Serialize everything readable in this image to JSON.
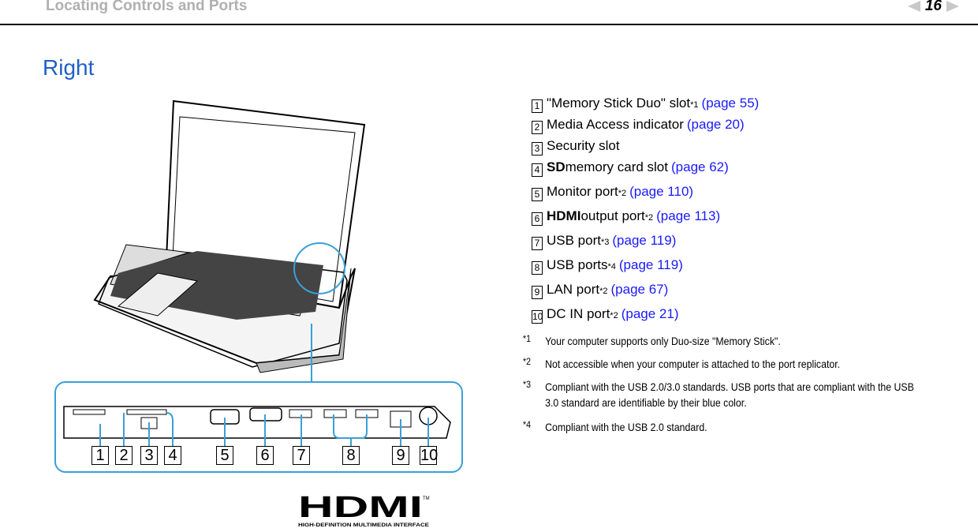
{
  "header": {
    "section": "Locating Controls and Ports",
    "page": "16"
  },
  "title": "Right",
  "items": [
    {
      "n": "1",
      "pre": "",
      "bold": "",
      "text": "\"Memory Stick Duo\" slot",
      "sup": "*1",
      "link": "(page 55)"
    },
    {
      "n": "2",
      "pre": "",
      "bold": "",
      "text": "Media Access indicator",
      "sup": "",
      "link": "(page 20)"
    },
    {
      "n": "3",
      "pre": "",
      "bold": "",
      "text": "Security slot",
      "sup": "",
      "link": ""
    },
    {
      "n": "4",
      "bold": "SD",
      "text": " memory card slot",
      "sup": "",
      "link": "(page 62)"
    },
    {
      "n": "5",
      "bold": "",
      "text": "Monitor port",
      "sup": "*2",
      "link": "(page 110)"
    },
    {
      "n": "6",
      "bold": "HDMI",
      "text": " output port",
      "sup": "*2",
      "link": "(page 113)"
    },
    {
      "n": "7",
      "bold": "",
      "text": "USB port",
      "sup": "*3",
      "link": "(page 119)"
    },
    {
      "n": "8",
      "bold": "",
      "text": "USB ports",
      "sup": "*4",
      "link": "(page 119)"
    },
    {
      "n": "9",
      "bold": "",
      "text": "LAN port",
      "sup": "*2",
      "link": "(page 67)"
    },
    {
      "n": "10",
      "bold": "",
      "text": "DC IN port",
      "sup": "*2",
      "link": "(page 21)"
    }
  ],
  "footnotes": [
    {
      "k": "*1",
      "t": "Your computer supports only Duo-size \"Memory Stick\"."
    },
    {
      "k": "*2",
      "t": "Not accessible when your computer is attached to the port replicator."
    },
    {
      "k": "*3",
      "t": "Compliant with the USB 2.0/3.0 standards. USB ports that are compliant with the USB 3.0 standard are identifiable by their blue color."
    },
    {
      "k": "*4",
      "t": "Compliant with the USB 2.0 standard."
    }
  ],
  "callouts": [
    "1",
    "2",
    "3",
    "4",
    "5",
    "6",
    "7",
    "8",
    "9",
    "10"
  ],
  "logo": {
    "text": "HDMI",
    "tagline": "HIGH-DEFINITION MULTIMEDIA INTERFACE",
    "tm": "TM"
  },
  "colors": {
    "title": "#1f5fc8",
    "link": "#1a1aff",
    "inset_border": "#3aa0d8"
  }
}
